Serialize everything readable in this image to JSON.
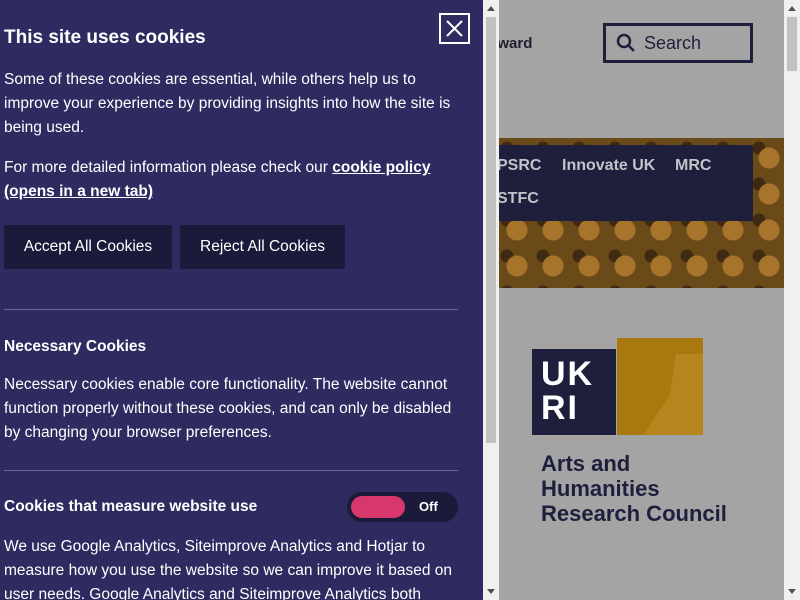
{
  "background": {
    "award_text": "award",
    "search_placeholder": "Search",
    "nav_items": [
      "PSRC",
      "Innovate UK",
      "MRC",
      "STFC"
    ],
    "logo": {
      "letters": "UKRI",
      "council_name": [
        "Arts and",
        "Humanities",
        "Research Council"
      ]
    }
  },
  "cookie_banner": {
    "title": "This site uses cookies",
    "intro": "Some of these cookies are essential, while others help us to improve your experience by providing insights into how the site is being used.",
    "more_info_prefix": "For more detailed information please check our ",
    "policy_link": "cookie policy (opens in a new tab)",
    "accept_label": "Accept All Cookies",
    "reject_label": "Reject All Cookies",
    "sections": [
      {
        "title": "Necessary Cookies",
        "body": "Necessary cookies enable core functionality. The website cannot function properly without these cookies, and can only be disabled by changing your browser preferences."
      },
      {
        "title": "Cookies that measure website use",
        "toggle_state": "Off",
        "body": "We use Google Analytics, Siteimprove Analytics and Hotjar to measure how you use the website so we can improve it based on user needs. Google Analytics and Siteimprove Analytics both"
      }
    ]
  },
  "colors": {
    "panel_bg": "#2e2b61",
    "button_bg": "#1b1a3a",
    "toggle_knob": "#d6386b",
    "nav_bg": "#1e1f3d",
    "logo_gold": "#a9790f"
  }
}
